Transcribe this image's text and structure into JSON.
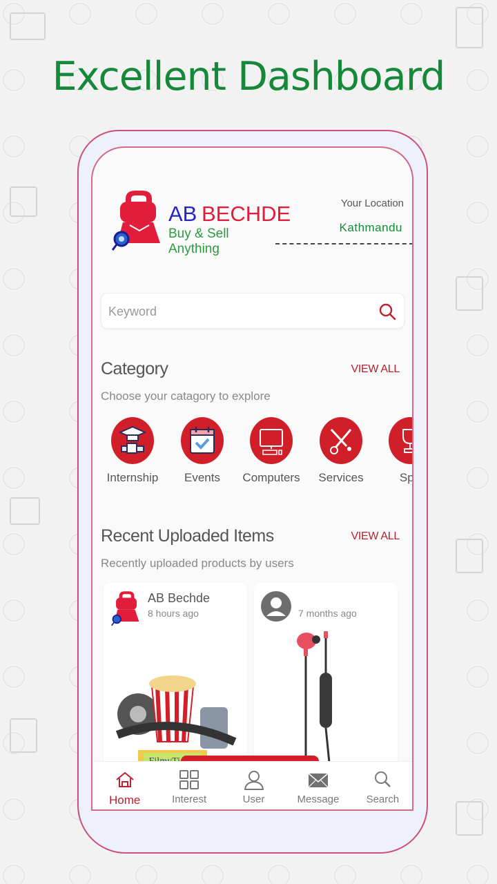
{
  "headline": "Excellent Dashboard",
  "colors": {
    "headline": "#16883a",
    "brand_red": "#d11f2a",
    "accent_red": "#b5202e",
    "brand_blue": "#2323c8",
    "brand_green": "#2c9a40"
  },
  "app": {
    "logo": {
      "name_part1": "AB",
      "name_part2": "BECHDE",
      "tagline": "Buy & Sell Anything",
      "icon": "shopping-bag-person-icon"
    },
    "location": {
      "label": "Your Location",
      "value": "Kathmandu"
    },
    "search": {
      "placeholder": "Keyword",
      "icon": "search-icon"
    },
    "category": {
      "title": "Category",
      "subtitle": "Choose your catagory to explore",
      "view_all": "VIEW ALL",
      "items": [
        {
          "label": "Internship",
          "icon": "graduation-cap-icon"
        },
        {
          "label": "Events",
          "icon": "calendar-check-icon"
        },
        {
          "label": "Computers",
          "icon": "desktop-computer-icon"
        },
        {
          "label": "Services",
          "icon": "tools-icon"
        },
        {
          "label": "Spo",
          "icon": "trophy-icon"
        }
      ]
    },
    "recent": {
      "title": "Recent Uploaded Items",
      "subtitle": "Recently uploaded products by users",
      "view_all": "VIEW ALL",
      "items": [
        {
          "user": "AB Bechde",
          "time": "8 hours ago",
          "image": "movie-popcorn-ticket-image",
          "image_caption": "FilmyTicket"
        },
        {
          "user": "",
          "time": "7 months ago",
          "image": "red-earphones-image"
        }
      ]
    },
    "bottom_nav": [
      {
        "label": "Home",
        "icon": "home-icon",
        "active": true
      },
      {
        "label": "Interest",
        "icon": "grid-icon",
        "active": false
      },
      {
        "label": "User",
        "icon": "user-icon",
        "active": false
      },
      {
        "label": "Message",
        "icon": "envelope-icon",
        "active": false
      },
      {
        "label": "Search",
        "icon": "search-icon",
        "active": false
      }
    ]
  }
}
